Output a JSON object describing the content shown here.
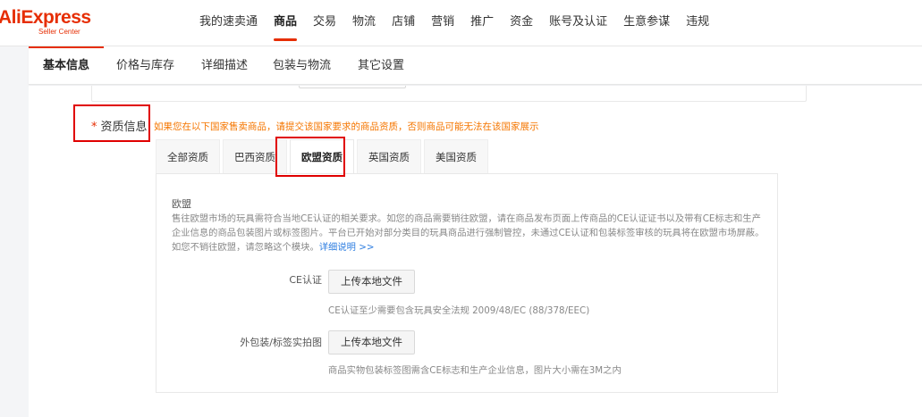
{
  "brand": {
    "name": "AliExpress",
    "sub": "Seller Center",
    "color": "#e62e04"
  },
  "nav": [
    {
      "label": "我的速卖通",
      "active": false
    },
    {
      "label": "商品",
      "active": true
    },
    {
      "label": "交易",
      "active": false
    },
    {
      "label": "物流",
      "active": false
    },
    {
      "label": "店铺",
      "active": false
    },
    {
      "label": "营销",
      "active": false
    },
    {
      "label": "推广",
      "active": false
    },
    {
      "label": "资金",
      "active": false
    },
    {
      "label": "账号及认证",
      "active": false
    },
    {
      "label": "生意参谋",
      "active": false
    },
    {
      "label": "违规",
      "active": false
    }
  ],
  "subtabs": [
    {
      "label": "基本信息",
      "active": true
    },
    {
      "label": "价格与库存",
      "active": false
    },
    {
      "label": "详细描述",
      "active": false
    },
    {
      "label": "包装与物流",
      "active": false
    },
    {
      "label": "其它设置",
      "active": false
    }
  ],
  "qualification": {
    "label": "资质信息",
    "required_mark": "*",
    "hint": "如果您在以下国家售卖商品，请提交该国家要求的商品资质，否则商品可能无法在该国家展示",
    "tabs": [
      {
        "label": "全部资质",
        "active": false
      },
      {
        "label": "巴西资质",
        "active": false
      },
      {
        "label": "欧盟资质",
        "active": true
      },
      {
        "label": "英国资质",
        "active": false
      },
      {
        "label": "美国资质",
        "active": false
      }
    ],
    "panel": {
      "title": "欧盟",
      "description": "售往欧盟市场的玩具需符合当地CE认证的相关要求。如您的商品需要销往欧盟，请在商品发布页面上传商品的CE认证证书以及带有CE标志和生产企业信息的商品包装图片或标签图片。平台已开始对部分类目的玩具商品进行强制管控，未通过CE认证和包装标签审核的玩具将在欧盟市场屏蔽。如您不销往欧盟，请忽略这个模块。",
      "link": "详细说明 >>",
      "fields": [
        {
          "label": "CE认证",
          "button": "上传本地文件",
          "hint": "CE认证至少需要包含玩具安全法规 2009/48/EC (88/378/EEC)"
        },
        {
          "label": "外包装/标签实拍图",
          "button": "上传本地文件",
          "hint": "商品实物包装标签图需含CE标志和生产企业信息，图片大小需在3M之内"
        }
      ]
    }
  }
}
